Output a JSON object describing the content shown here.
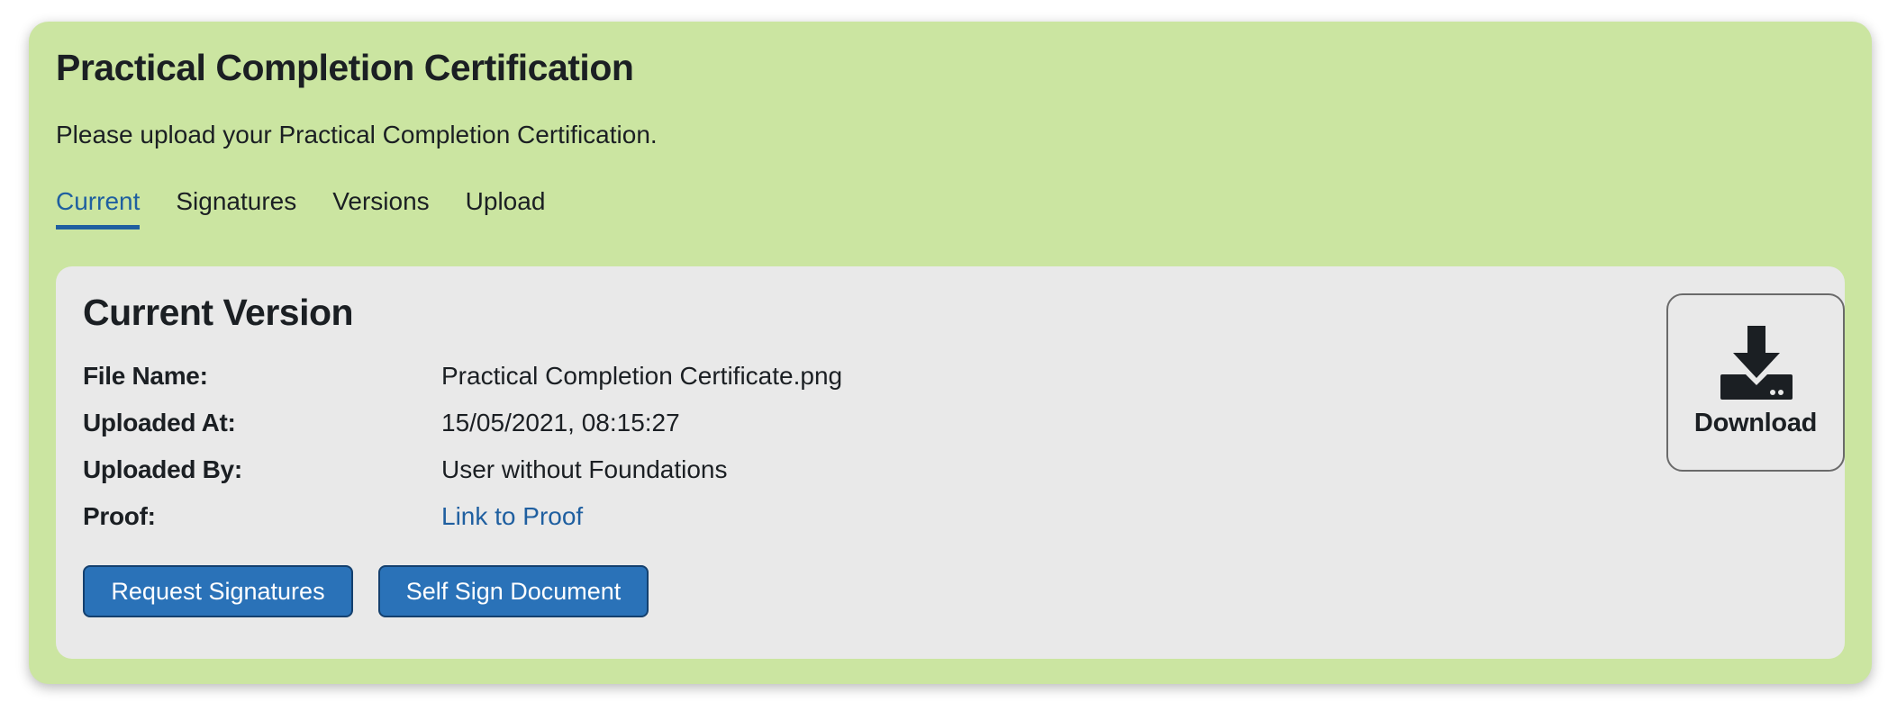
{
  "card": {
    "title": "Practical Completion Certification",
    "subtitle": "Please upload your Practical Completion Certification."
  },
  "tabs": [
    {
      "label": "Current",
      "active": true
    },
    {
      "label": "Signatures",
      "active": false
    },
    {
      "label": "Versions",
      "active": false
    },
    {
      "label": "Upload",
      "active": false
    }
  ],
  "current_version": {
    "title": "Current Version",
    "fields": [
      {
        "label": "File Name:",
        "value": "Practical Completion Certificate.png"
      },
      {
        "label": "Uploaded At:",
        "value": "15/05/2021, 08:15:27"
      },
      {
        "label": "Uploaded By:",
        "value": "User without Foundations"
      },
      {
        "label": "Proof:",
        "value": "Link to Proof"
      }
    ],
    "buttons": {
      "request_signatures": "Request Signatures",
      "self_sign": "Self Sign Document"
    },
    "download": {
      "label": "Download",
      "icon": "download-icon"
    }
  },
  "colors": {
    "card_background": "#cbe5a1",
    "panel_background": "#e9e9e9",
    "accent": "#1f5fa0",
    "button": "#2a72b8"
  }
}
